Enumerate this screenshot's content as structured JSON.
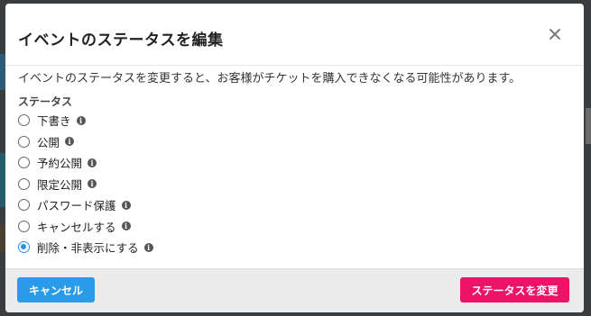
{
  "modal": {
    "title": "イベントのステータスを編集",
    "description": "イベントのステータスを変更すると、お客様がチケットを購入できなくなる可能性があります。",
    "section_label": "ステータス",
    "options": [
      {
        "label": "下書き",
        "selected": false
      },
      {
        "label": "公開",
        "selected": false
      },
      {
        "label": "予約公開",
        "selected": false
      },
      {
        "label": "限定公開",
        "selected": false
      },
      {
        "label": "パスワード保護",
        "selected": false
      },
      {
        "label": "キャンセルする",
        "selected": false
      },
      {
        "label": "削除・非表示にする",
        "selected": true
      }
    ],
    "info_glyph": "i",
    "cancel_label": "キャンセル",
    "submit_label": "ステータスを変更"
  },
  "colors": {
    "primary_blue": "#2a9be8",
    "submit_pink": "#ec1369",
    "radio_selected": "#2a8ee8"
  },
  "icons": {
    "close": "close-icon",
    "info": "info-icon"
  }
}
